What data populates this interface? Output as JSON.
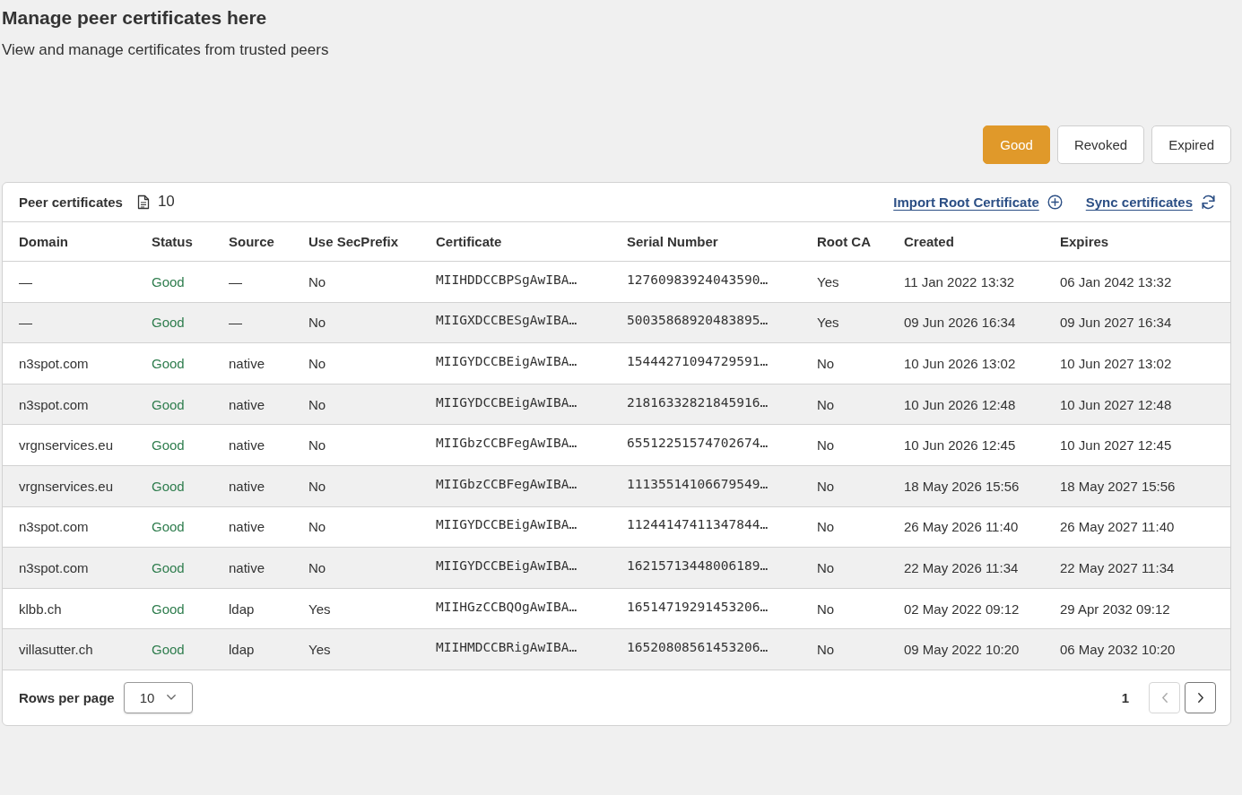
{
  "header": {
    "title": "Manage peer certificates here",
    "subtitle": "View and manage certificates from trusted peers"
  },
  "filters": [
    {
      "label": "Good",
      "selected": true
    },
    {
      "label": "Revoked",
      "selected": false
    },
    {
      "label": "Expired",
      "selected": false
    }
  ],
  "table": {
    "title": "Peer certificates",
    "count": "10",
    "actions": [
      {
        "label": "Import Root Certificate",
        "kind": "import"
      },
      {
        "label": "Sync certificates",
        "kind": "sync"
      }
    ],
    "columns": [
      {
        "label": "Domain",
        "kind": "text"
      },
      {
        "label": "Status",
        "kind": "status"
      },
      {
        "label": "Source",
        "kind": "text"
      },
      {
        "label": "Use SecPrefix",
        "kind": "text"
      },
      {
        "label": "Certificate",
        "kind": "mono"
      },
      {
        "label": "Serial Number",
        "kind": "mono"
      },
      {
        "label": "Root CA",
        "kind": "text"
      },
      {
        "label": "Created",
        "kind": "text"
      },
      {
        "label": "Expires",
        "kind": "text"
      }
    ],
    "rows": [
      [
        "—",
        "Good",
        "—",
        "No",
        "MIIHDDCCBPSgAwIBA…",
        "12760983924043590…",
        "Yes",
        "11 Jan 2022 13:32",
        "06 Jan 2042 13:32"
      ],
      [
        "—",
        "Good",
        "—",
        "No",
        "MIIGXDCCBESgAwIBA…",
        "50035868920483895…",
        "Yes",
        "09 Jun 2026 16:34",
        "09 Jun 2027 16:34"
      ],
      [
        "n3spot.com",
        "Good",
        "native",
        "No",
        "MIIGYDCCBEigAwIBA…",
        "15444271094729591…",
        "No",
        "10 Jun 2026 13:02",
        "10 Jun 2027 13:02"
      ],
      [
        "n3spot.com",
        "Good",
        "native",
        "No",
        "MIIGYDCCBEigAwIBA…",
        "21816332821845916…",
        "No",
        "10 Jun 2026 12:48",
        "10 Jun 2027 12:48"
      ],
      [
        "vrgnservices.eu",
        "Good",
        "native",
        "No",
        "MIIGbzCCBFegAwIBA…",
        "65512251574702674…",
        "No",
        "10 Jun 2026 12:45",
        "10 Jun 2027 12:45"
      ],
      [
        "vrgnservices.eu",
        "Good",
        "native",
        "No",
        "MIIGbzCCBFegAwIBA…",
        "11135514106679549…",
        "No",
        "18 May 2026 15:56",
        "18 May 2027 15:56"
      ],
      [
        "n3spot.com",
        "Good",
        "native",
        "No",
        "MIIGYDCCBEigAwIBA…",
        "11244147411347844…",
        "No",
        "26 May 2026 11:40",
        "26 May 2027 11:40"
      ],
      [
        "n3spot.com",
        "Good",
        "native",
        "No",
        "MIIGYDCCBEigAwIBA…",
        "16215713448006189…",
        "No",
        "22 May 2026 11:34",
        "22 May 2027 11:34"
      ],
      [
        "klbb.ch",
        "Good",
        "ldap",
        "Yes",
        "MIIHGzCCBQOgAwIBA…",
        "16514719291453206…",
        "No",
        "02 May 2022 09:12",
        "29 Apr 2032 09:12"
      ],
      [
        "villasutter.ch",
        "Good",
        "ldap",
        "Yes",
        "MIIHMDCCBRigAwIBA…",
        "16520808561453206…",
        "No",
        "09 May 2022 10:20",
        "06 May 2032 10:20"
      ]
    ]
  },
  "pagination": {
    "rows_per_page_label": "Rows per page",
    "rows_per_page": "10",
    "page": "1",
    "previous": {
      "disabled": true
    },
    "next": {
      "disabled": false
    }
  }
}
